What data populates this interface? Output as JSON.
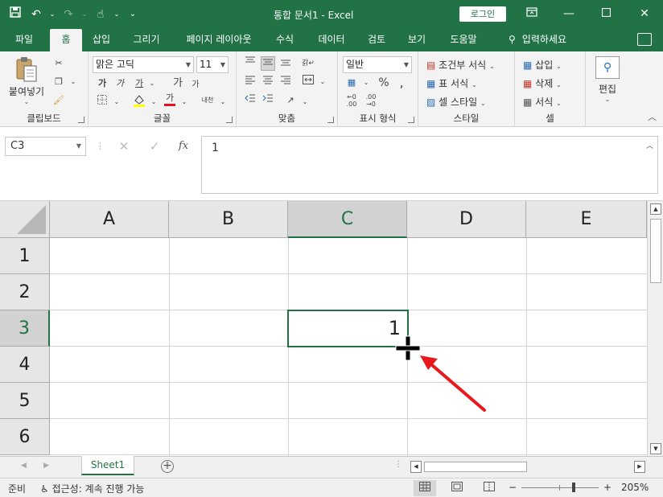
{
  "app": {
    "title": "통합 문서1  -  Excel",
    "login_label": "로그인",
    "accent": "#217346"
  },
  "qat": {
    "save_icon": "save-icon",
    "undo_icon": "undo-icon",
    "redo_icon": "redo-icon",
    "touch_icon": "touch-mode-icon"
  },
  "tabs": [
    {
      "label": "파일"
    },
    {
      "label": "홈"
    },
    {
      "label": "삽입"
    },
    {
      "label": "그리기"
    },
    {
      "label": "페이지 레이아웃"
    },
    {
      "label": "수식"
    },
    {
      "label": "데이터"
    },
    {
      "label": "검토"
    },
    {
      "label": "보기"
    },
    {
      "label": "도움말"
    },
    {
      "label": "입력하세요"
    }
  ],
  "ribbon": {
    "clipboard": {
      "paste_label": "붙여넣기",
      "group_label": "클립보드"
    },
    "font": {
      "font_name": "맑은 고딕",
      "font_size": "11",
      "group_label": "글꼴",
      "bold": "가",
      "italic": "가",
      "underline": "가",
      "grow": "가",
      "shrink": "가",
      "font_color_glyph": "가",
      "phonetic": "내천"
    },
    "alignment": {
      "group_label": "맞춤"
    },
    "number": {
      "format": "일반",
      "group_label": "표시 형식",
      "percent": "%"
    },
    "styles": {
      "conditional": "조건부 서식",
      "table": "표 서식",
      "cell": "셀 스타일",
      "group_label": "스타일"
    },
    "cells": {
      "insert": "삽입",
      "delete": "삭제",
      "format": "서식",
      "group_label": "셀"
    },
    "editing": {
      "label": "편집"
    }
  },
  "formula_bar": {
    "name_box": "C3",
    "fx": "fx",
    "value": "1"
  },
  "grid": {
    "columns": [
      "A",
      "B",
      "C",
      "D",
      "E"
    ],
    "rows": [
      "1",
      "2",
      "3",
      "4",
      "5",
      "6"
    ],
    "selected_column": "C",
    "selected_row": "3",
    "active_cell_value": "1"
  },
  "sheets": {
    "tabs": [
      {
        "label": "Sheet1"
      }
    ],
    "add": "+"
  },
  "status": {
    "ready": "준비",
    "accessibility": "접근성: 계속 진행 가능",
    "zoom": "205%",
    "zoom_minus": "−",
    "zoom_plus": "+"
  }
}
